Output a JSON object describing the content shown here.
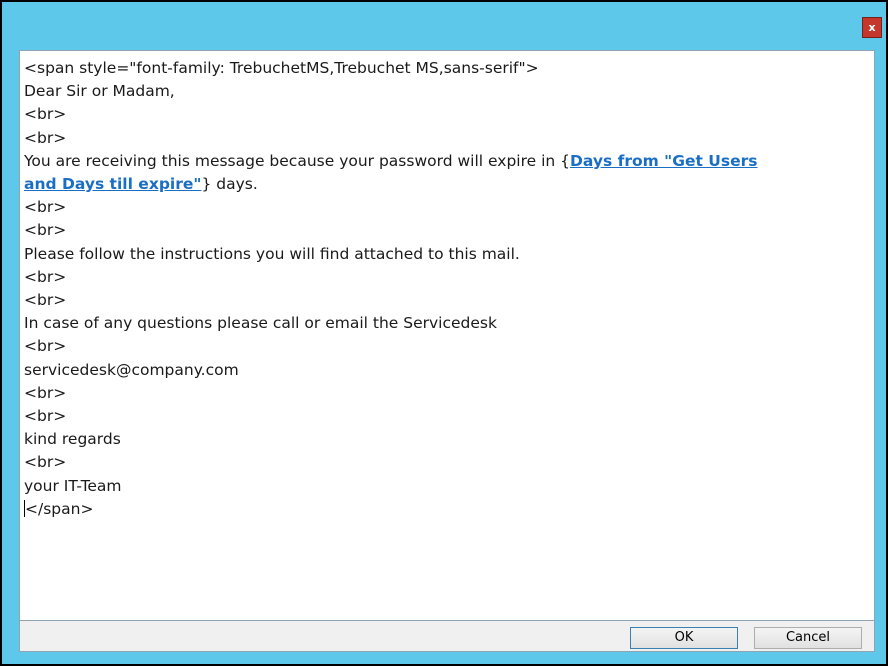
{
  "window": {
    "close_label": "x"
  },
  "editor": {
    "lines": [
      "<span style=\"font-family: TrebuchetMS,Trebuchet MS,sans-serif\">",
      "Dear Sir or Madam,",
      "<br>",
      "<br>"
    ],
    "expire_line_prefix": "You are receiving this message because your password will expire in {",
    "link_text_part1": "Days from \"Get Users",
    "link_text_part2": "and Days till expire\"",
    "expire_line_suffix": "} days.",
    "lines_after": [
      "<br>",
      "<br>",
      "Please follow the instructions you will find attached to this mail.",
      "<br>",
      "<br>",
      "In case of any questions please call or email the Servicedesk",
      "<br>",
      "servicedesk@company.com",
      "<br>",
      "<br>",
      "kind regards",
      "<br>",
      "your IT-Team"
    ],
    "last_line": "</span>"
  },
  "buttons": {
    "ok_label": "OK",
    "cancel_label": "Cancel"
  },
  "colors": {
    "window_frame": "#5ec8ea",
    "close_button": "#c5372c",
    "link": "#1a6fc4"
  }
}
